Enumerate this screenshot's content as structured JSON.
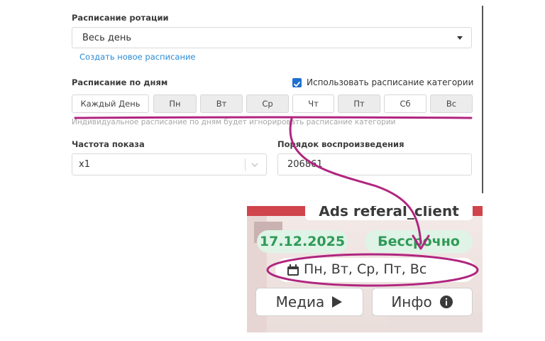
{
  "rotation": {
    "label": "Расписание ротации",
    "selected": "Весь день",
    "create_link": "Создать новое расписание"
  },
  "by_days": {
    "label": "Расписание по дням",
    "use_category_label": "Использовать расписание категории",
    "use_category_checked": true,
    "days": [
      {
        "label": "Каждый День",
        "active": false
      },
      {
        "label": "Пн",
        "active": true
      },
      {
        "label": "Вт",
        "active": true
      },
      {
        "label": "Ср",
        "active": true
      },
      {
        "label": "Чт",
        "active": false
      },
      {
        "label": "Пт",
        "active": true
      },
      {
        "label": "Сб",
        "active": false
      },
      {
        "label": "Вс",
        "active": true
      }
    ],
    "hint": "Индивидуальное расписание по дням будет игнорировать расписание категории"
  },
  "frequency": {
    "label": "Частота показа",
    "value": "x1"
  },
  "order": {
    "label": "Порядок воспроизведения",
    "value": "206861"
  },
  "preview": {
    "title": "Ads referal_client",
    "date": "17.12.2025",
    "duration": "Бессрочно",
    "days": "Пн,  Вт,  Ср,  Пт,  Вс",
    "media_button": "Медиа",
    "info_button": "Инфо"
  },
  "colors": {
    "accent": "#b0257f",
    "link": "#2a8bd6",
    "checkbox": "#1f6fd1",
    "pill_green_bg": "#dff3e6",
    "pill_green_text": "#2f9a57"
  }
}
